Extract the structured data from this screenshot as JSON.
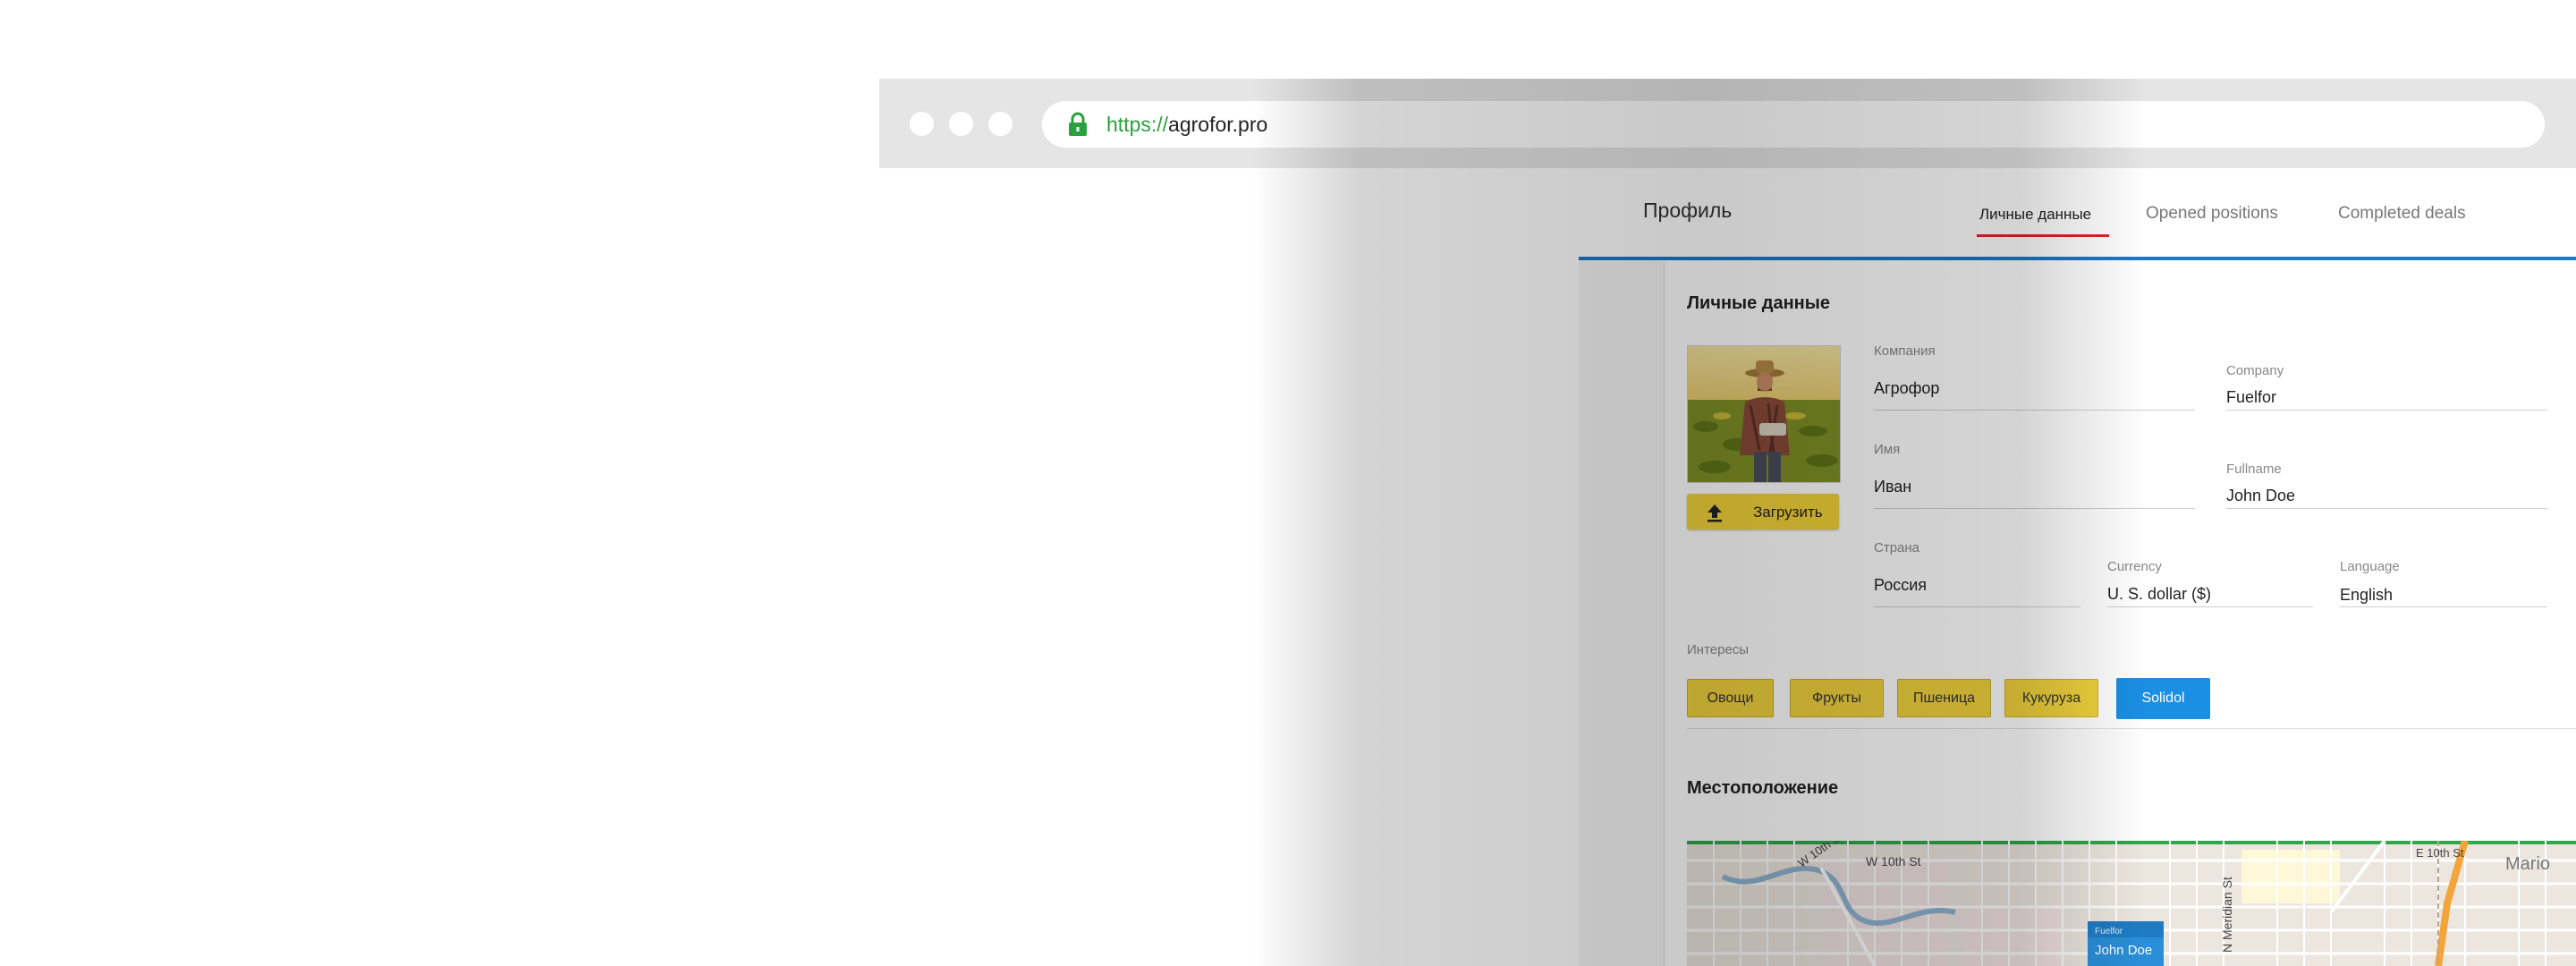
{
  "browser": {
    "url_protocol": "https://",
    "url_host": "agrofor.pro"
  },
  "header": {
    "title": "Профиль",
    "tabs": [
      {
        "label": "Личные данные",
        "active": true
      },
      {
        "label": "Opened positions",
        "active": false
      },
      {
        "label": "Completed deals",
        "active": false
      }
    ]
  },
  "personal": {
    "section_title": "Личные данные",
    "upload_label": "Загрузить",
    "fields": {
      "company_ru": {
        "label": "Компания",
        "value": "Агрофор"
      },
      "company_en": {
        "label": "Company",
        "value": "Fuelfor"
      },
      "name_ru": {
        "label": "Имя",
        "value": "Иван"
      },
      "name_en": {
        "label": "Fullname",
        "value": "John Doe"
      },
      "country": {
        "label": "Страна",
        "value": "Россия"
      },
      "currency": {
        "label": "Currency",
        "value": "U. S. dollar  ($)"
      },
      "language": {
        "label": "Language",
        "value": "English"
      }
    },
    "interests_label": "Интересы",
    "interests": [
      "Овощи",
      "Фрукты",
      "Пшеница",
      "Кукуруза",
      "Solidol"
    ]
  },
  "location": {
    "section_title": "Местоположение",
    "map_labels": {
      "w10th_ave": "W 10th St",
      "w10th_st": "W 10th St",
      "n_meridian": "N Meridian St",
      "e10th": "E 10th St",
      "marion": "Mario",
      "popup_title": "Fuelfor",
      "popup_name": "John Doe"
    }
  },
  "colors": {
    "accent_blue": "#1e78c8",
    "tab_underline": "#e02424",
    "chip_yellow": "#f0d23d",
    "chip_blue": "#1a8fe3",
    "secure_green": "#2aa13e"
  }
}
